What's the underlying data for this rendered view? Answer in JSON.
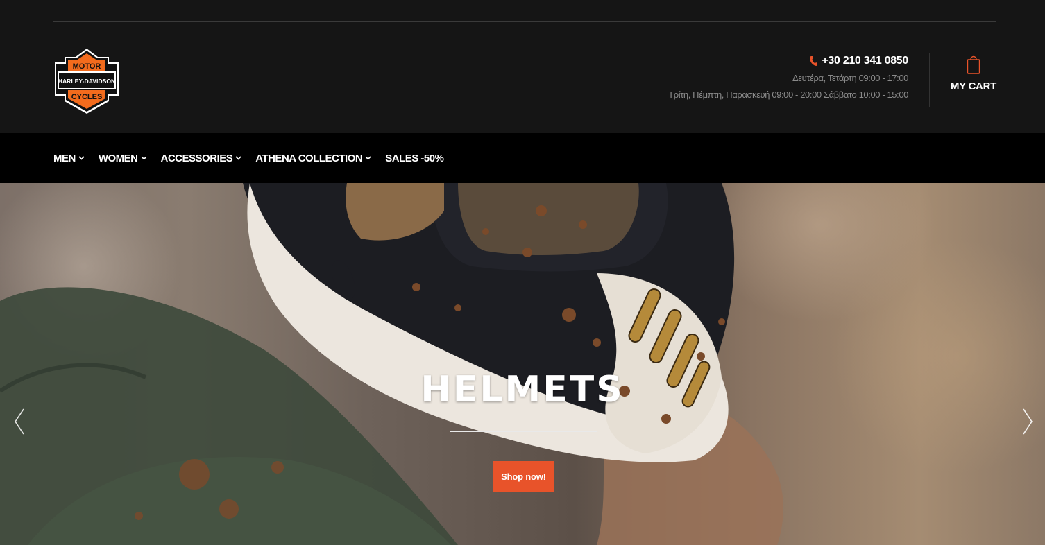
{
  "brand": {
    "logo_top": "MOTOR",
    "logo_middle": "HARLEY-DAVIDSON",
    "logo_bottom": "CYCLES",
    "accent_color": "#e8532a"
  },
  "contact": {
    "phone_icon": "phone-icon",
    "phone": "+30 210 341 0850",
    "hours_line1_days": "Δευτέρα, Τετάρτη",
    "hours_line1_time": "09:00 - 17:00",
    "hours_line2_days": "Τρίτη, Πέμπτη, Παρασκευή",
    "hours_line2_time": "09:00 - 20:00",
    "hours_line2_days_b": "Σάββατο",
    "hours_line2_time_b": "10:00 - 15:00"
  },
  "cart": {
    "icon": "shopping-bag-icon",
    "label": "MY CART"
  },
  "nav": {
    "items": [
      {
        "label": "MEN",
        "has_dropdown": true
      },
      {
        "label": "WOMEN",
        "has_dropdown": true
      },
      {
        "label": "ACCESSORIES",
        "has_dropdown": true
      },
      {
        "label": "ATHENA COLLECTION",
        "has_dropdown": true
      },
      {
        "label": "SALES -50%",
        "has_dropdown": false
      }
    ]
  },
  "hero": {
    "title": "HELMETS",
    "cta_label": "Shop now!",
    "prev_icon": "chevron-left-icon",
    "next_icon": "chevron-right-icon"
  }
}
